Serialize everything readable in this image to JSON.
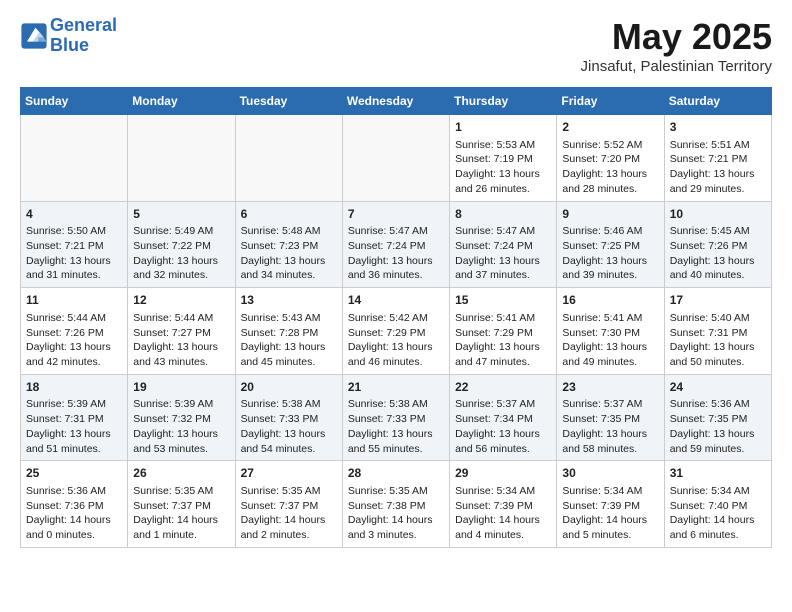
{
  "header": {
    "logo_line1": "General",
    "logo_line2": "Blue",
    "month": "May 2025",
    "location": "Jinsafut, Palestinian Territory"
  },
  "weekdays": [
    "Sunday",
    "Monday",
    "Tuesday",
    "Wednesday",
    "Thursday",
    "Friday",
    "Saturday"
  ],
  "weeks": [
    [
      {
        "day": "",
        "content": ""
      },
      {
        "day": "",
        "content": ""
      },
      {
        "day": "",
        "content": ""
      },
      {
        "day": "",
        "content": ""
      },
      {
        "day": "1",
        "content": "Sunrise: 5:53 AM\nSunset: 7:19 PM\nDaylight: 13 hours\nand 26 minutes."
      },
      {
        "day": "2",
        "content": "Sunrise: 5:52 AM\nSunset: 7:20 PM\nDaylight: 13 hours\nand 28 minutes."
      },
      {
        "day": "3",
        "content": "Sunrise: 5:51 AM\nSunset: 7:21 PM\nDaylight: 13 hours\nand 29 minutes."
      }
    ],
    [
      {
        "day": "4",
        "content": "Sunrise: 5:50 AM\nSunset: 7:21 PM\nDaylight: 13 hours\nand 31 minutes."
      },
      {
        "day": "5",
        "content": "Sunrise: 5:49 AM\nSunset: 7:22 PM\nDaylight: 13 hours\nand 32 minutes."
      },
      {
        "day": "6",
        "content": "Sunrise: 5:48 AM\nSunset: 7:23 PM\nDaylight: 13 hours\nand 34 minutes."
      },
      {
        "day": "7",
        "content": "Sunrise: 5:47 AM\nSunset: 7:24 PM\nDaylight: 13 hours\nand 36 minutes."
      },
      {
        "day": "8",
        "content": "Sunrise: 5:47 AM\nSunset: 7:24 PM\nDaylight: 13 hours\nand 37 minutes."
      },
      {
        "day": "9",
        "content": "Sunrise: 5:46 AM\nSunset: 7:25 PM\nDaylight: 13 hours\nand 39 minutes."
      },
      {
        "day": "10",
        "content": "Sunrise: 5:45 AM\nSunset: 7:26 PM\nDaylight: 13 hours\nand 40 minutes."
      }
    ],
    [
      {
        "day": "11",
        "content": "Sunrise: 5:44 AM\nSunset: 7:26 PM\nDaylight: 13 hours\nand 42 minutes."
      },
      {
        "day": "12",
        "content": "Sunrise: 5:44 AM\nSunset: 7:27 PM\nDaylight: 13 hours\nand 43 minutes."
      },
      {
        "day": "13",
        "content": "Sunrise: 5:43 AM\nSunset: 7:28 PM\nDaylight: 13 hours\nand 45 minutes."
      },
      {
        "day": "14",
        "content": "Sunrise: 5:42 AM\nSunset: 7:29 PM\nDaylight: 13 hours\nand 46 minutes."
      },
      {
        "day": "15",
        "content": "Sunrise: 5:41 AM\nSunset: 7:29 PM\nDaylight: 13 hours\nand 47 minutes."
      },
      {
        "day": "16",
        "content": "Sunrise: 5:41 AM\nSunset: 7:30 PM\nDaylight: 13 hours\nand 49 minutes."
      },
      {
        "day": "17",
        "content": "Sunrise: 5:40 AM\nSunset: 7:31 PM\nDaylight: 13 hours\nand 50 minutes."
      }
    ],
    [
      {
        "day": "18",
        "content": "Sunrise: 5:39 AM\nSunset: 7:31 PM\nDaylight: 13 hours\nand 51 minutes."
      },
      {
        "day": "19",
        "content": "Sunrise: 5:39 AM\nSunset: 7:32 PM\nDaylight: 13 hours\nand 53 minutes."
      },
      {
        "day": "20",
        "content": "Sunrise: 5:38 AM\nSunset: 7:33 PM\nDaylight: 13 hours\nand 54 minutes."
      },
      {
        "day": "21",
        "content": "Sunrise: 5:38 AM\nSunset: 7:33 PM\nDaylight: 13 hours\nand 55 minutes."
      },
      {
        "day": "22",
        "content": "Sunrise: 5:37 AM\nSunset: 7:34 PM\nDaylight: 13 hours\nand 56 minutes."
      },
      {
        "day": "23",
        "content": "Sunrise: 5:37 AM\nSunset: 7:35 PM\nDaylight: 13 hours\nand 58 minutes."
      },
      {
        "day": "24",
        "content": "Sunrise: 5:36 AM\nSunset: 7:35 PM\nDaylight: 13 hours\nand 59 minutes."
      }
    ],
    [
      {
        "day": "25",
        "content": "Sunrise: 5:36 AM\nSunset: 7:36 PM\nDaylight: 14 hours\nand 0 minutes."
      },
      {
        "day": "26",
        "content": "Sunrise: 5:35 AM\nSunset: 7:37 PM\nDaylight: 14 hours\nand 1 minute."
      },
      {
        "day": "27",
        "content": "Sunrise: 5:35 AM\nSunset: 7:37 PM\nDaylight: 14 hours\nand 2 minutes."
      },
      {
        "day": "28",
        "content": "Sunrise: 5:35 AM\nSunset: 7:38 PM\nDaylight: 14 hours\nand 3 minutes."
      },
      {
        "day": "29",
        "content": "Sunrise: 5:34 AM\nSunset: 7:39 PM\nDaylight: 14 hours\nand 4 minutes."
      },
      {
        "day": "30",
        "content": "Sunrise: 5:34 AM\nSunset: 7:39 PM\nDaylight: 14 hours\nand 5 minutes."
      },
      {
        "day": "31",
        "content": "Sunrise: 5:34 AM\nSunset: 7:40 PM\nDaylight: 14 hours\nand 6 minutes."
      }
    ]
  ]
}
